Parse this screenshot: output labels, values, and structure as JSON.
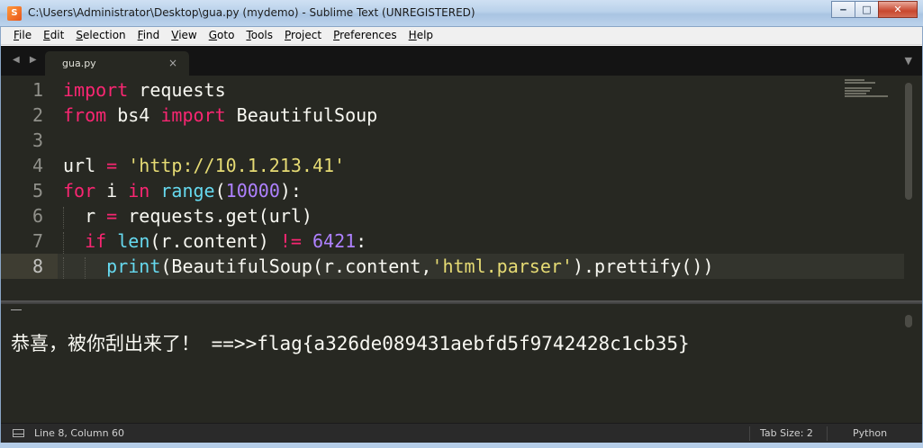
{
  "window": {
    "title": "C:\\Users\\Administrator\\Desktop\\gua.py (mydemo) - Sublime Text (UNREGISTERED)",
    "minimize_glyph": "‒",
    "maximize_glyph": "□",
    "close_glyph": "✕"
  },
  "menu": [
    {
      "u": "F",
      "rest": "ile"
    },
    {
      "u": "E",
      "rest": "dit"
    },
    {
      "u": "S",
      "rest": "election"
    },
    {
      "u": "F",
      "rest": "ind"
    },
    {
      "u": "V",
      "rest": "iew"
    },
    {
      "u": "G",
      "rest": "oto"
    },
    {
      "u": "T",
      "rest": "ools"
    },
    {
      "u": "P",
      "rest": "roject"
    },
    {
      "u": "P",
      "rest": "references"
    },
    {
      "u": "H",
      "rest": "elp"
    }
  ],
  "tabs": {
    "nav_glyphs": "◀ ▶",
    "active": {
      "label": "gua.py",
      "close_glyph": "×"
    },
    "dropdown_glyph": "▼"
  },
  "editor": {
    "line_numbers": [
      "1",
      "2",
      "3",
      "4",
      "5",
      "6",
      "7",
      "8"
    ],
    "active_line": "8",
    "lines": [
      [
        {
          "t": "import",
          "c": "kw"
        },
        {
          "t": " requests",
          "c": ""
        }
      ],
      [
        {
          "t": "from",
          "c": "kw"
        },
        {
          "t": " bs4 ",
          "c": ""
        },
        {
          "t": "import",
          "c": "kw"
        },
        {
          "t": " BeautifulSoup",
          "c": ""
        }
      ],
      [],
      [
        {
          "t": "url ",
          "c": ""
        },
        {
          "t": "=",
          "c": "kw"
        },
        {
          "t": " ",
          "c": ""
        },
        {
          "t": "'http://10.1.213.41'",
          "c": "str"
        }
      ],
      [
        {
          "t": "for",
          "c": "kw"
        },
        {
          "t": " i ",
          "c": ""
        },
        {
          "t": "in",
          "c": "kw"
        },
        {
          "t": " ",
          "c": ""
        },
        {
          "t": "range",
          "c": "bi"
        },
        {
          "t": "(",
          "c": ""
        },
        {
          "t": "10000",
          "c": "num"
        },
        {
          "t": "):",
          "c": ""
        }
      ],
      [
        {
          "t": "  r ",
          "c": ""
        },
        {
          "t": "=",
          "c": "kw"
        },
        {
          "t": " requests.get(url)",
          "c": ""
        }
      ],
      [
        {
          "t": "  ",
          "c": ""
        },
        {
          "t": "if",
          "c": "kw"
        },
        {
          "t": " ",
          "c": ""
        },
        {
          "t": "len",
          "c": "bi"
        },
        {
          "t": "(r.content) ",
          "c": ""
        },
        {
          "t": "!=",
          "c": "kw"
        },
        {
          "t": " ",
          "c": ""
        },
        {
          "t": "6421",
          "c": "num"
        },
        {
          "t": ":",
          "c": ""
        }
      ],
      [
        {
          "t": "    ",
          "c": ""
        },
        {
          "t": "print",
          "c": "bi"
        },
        {
          "t": "(BeautifulSoup(r.content,",
          "c": ""
        },
        {
          "t": "'html.parser'",
          "c": "str"
        },
        {
          "t": ").prettify())",
          "c": ""
        }
      ]
    ]
  },
  "output": {
    "text": "恭喜，被你刮出来了！ ==>>flag{a326de089431aebfd5f9742428c1cb35}"
  },
  "status": {
    "position": "Line 8, Column 60",
    "tab_size": "Tab Size: 2",
    "syntax": "Python"
  },
  "colors": {
    "editor_bg": "#272822",
    "keyword": "#f92672",
    "builtin": "#66d9ef",
    "string": "#e6db74",
    "number": "#ae81ff",
    "text": "#f8f8f2"
  }
}
